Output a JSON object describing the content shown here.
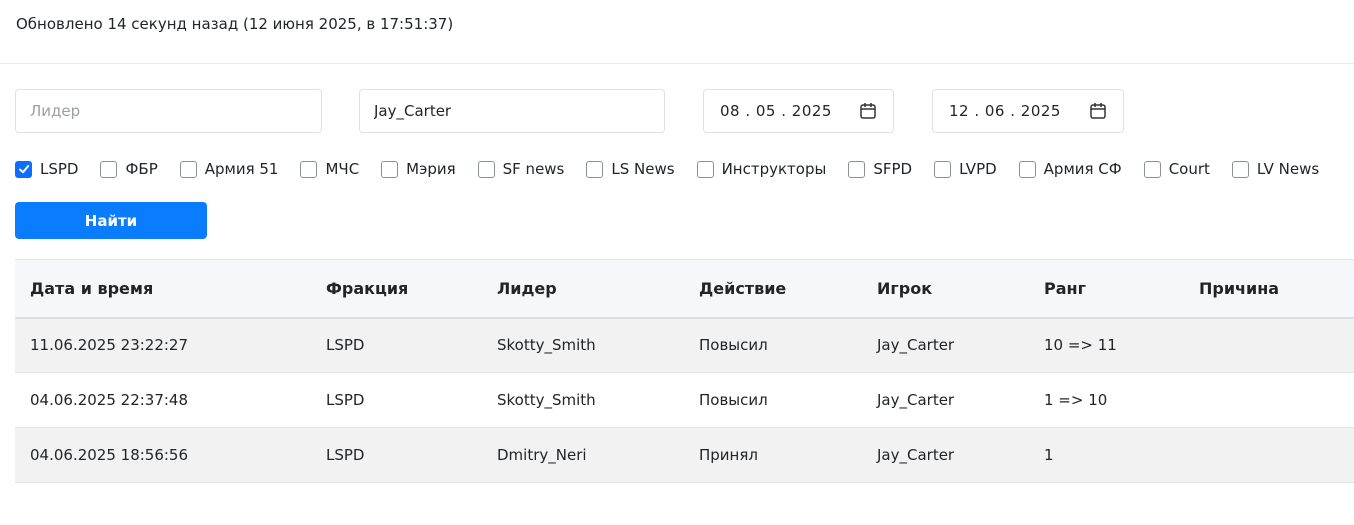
{
  "status": {
    "updated_text": "Обновлено 14 секунд назад (12 июня 2025, в 17:51:37)"
  },
  "filters": {
    "leader_placeholder": "Лидер",
    "leader_value": "",
    "player_value": "Jay_Carter",
    "date_from": "08 . 05 . 2025",
    "date_to": "12 . 06 . 2025"
  },
  "factions": [
    {
      "label": "LSPD",
      "checked": true
    },
    {
      "label": "ФБР",
      "checked": false
    },
    {
      "label": "Армия 51",
      "checked": false
    },
    {
      "label": "МЧС",
      "checked": false
    },
    {
      "label": "Мэрия",
      "checked": false
    },
    {
      "label": "SF news",
      "checked": false
    },
    {
      "label": "LS News",
      "checked": false
    },
    {
      "label": "Инструкторы",
      "checked": false
    },
    {
      "label": "SFPD",
      "checked": false
    },
    {
      "label": "LVPD",
      "checked": false
    },
    {
      "label": "Армия СФ",
      "checked": false
    },
    {
      "label": "Court",
      "checked": false
    },
    {
      "label": "LV News",
      "checked": false
    }
  ],
  "search_button": "Найти",
  "table": {
    "headers": [
      "Дата и время",
      "Фракция",
      "Лидер",
      "Действие",
      "Игрок",
      "Ранг",
      "Причина"
    ],
    "rows": [
      [
        "11.06.2025 23:22:27",
        "LSPD",
        "Skotty_Smith",
        "Повысил",
        "Jay_Carter",
        "10 => 11",
        ""
      ],
      [
        "04.06.2025 22:37:48",
        "LSPD",
        "Skotty_Smith",
        "Повысил",
        "Jay_Carter",
        "1 => 10",
        ""
      ],
      [
        "04.06.2025 18:56:56",
        "LSPD",
        "Dmitry_Neri",
        "Принял",
        "Jay_Carter",
        "1",
        ""
      ]
    ]
  },
  "colors": {
    "accent": "#0a7cff",
    "checkbox": "#0d6efd",
    "row_shade": "#f2f2f2",
    "header_bg": "#f5f7fa"
  }
}
